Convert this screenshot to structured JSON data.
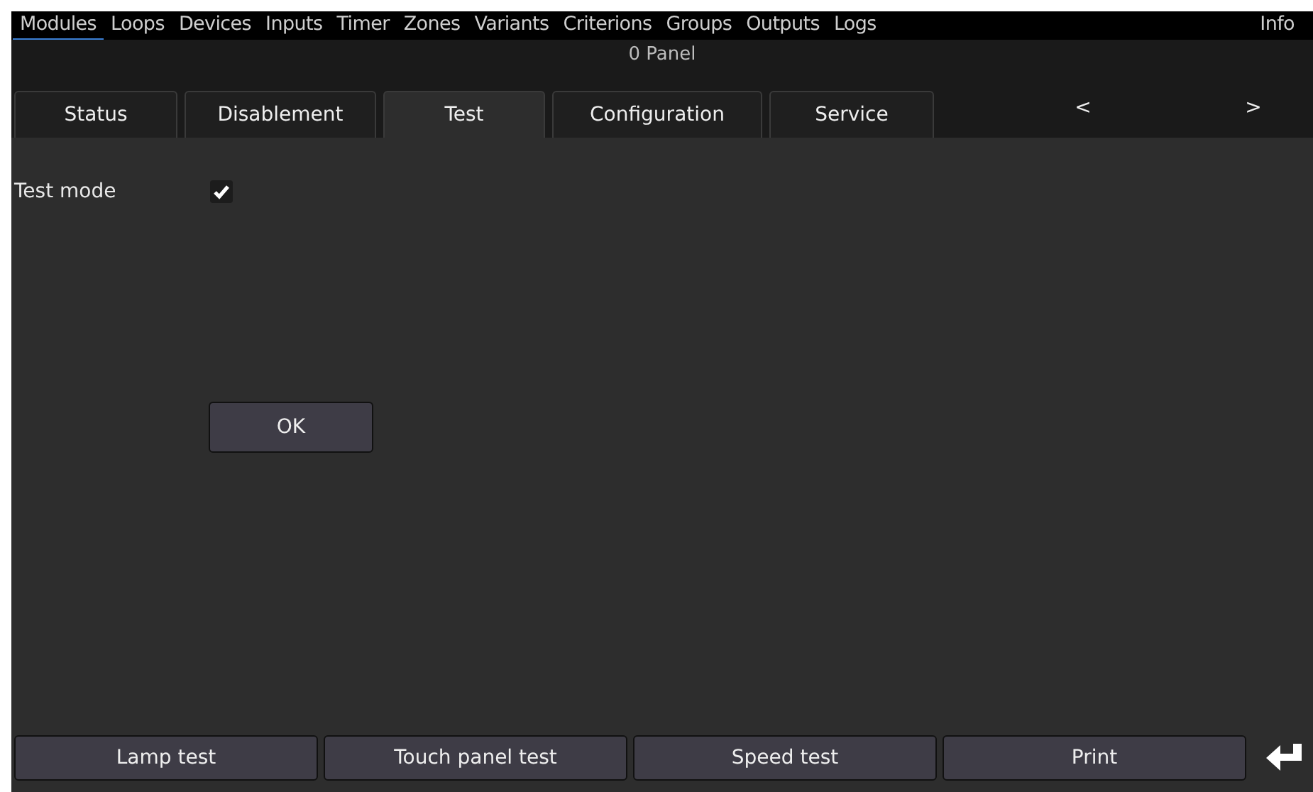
{
  "menu": [
    {
      "label": "Modules",
      "selected": true
    },
    {
      "label": "Loops",
      "selected": false
    },
    {
      "label": "Devices",
      "selected": false
    },
    {
      "label": "Inputs",
      "selected": false
    },
    {
      "label": "Timer",
      "selected": false
    },
    {
      "label": "Zones",
      "selected": false
    },
    {
      "label": "Variants",
      "selected": false
    },
    {
      "label": "Criterions",
      "selected": false
    },
    {
      "label": "Groups",
      "selected": false
    },
    {
      "label": "Outputs",
      "selected": false
    },
    {
      "label": "Logs",
      "selected": false
    },
    {
      "label": "Info",
      "selected": false
    }
  ],
  "subtitle": "0 Panel",
  "tabs": [
    {
      "label": "Status",
      "selected": false
    },
    {
      "label": "Disablement",
      "selected": false
    },
    {
      "label": "Test",
      "selected": true
    },
    {
      "label": "Configuration",
      "selected": false
    },
    {
      "label": "Service",
      "selected": false
    }
  ],
  "nav": [
    "<",
    ">"
  ],
  "test_mode": {
    "label": "Test mode",
    "checked": true
  },
  "ok_button": "OK",
  "bottom_buttons": [
    "Lamp test",
    "Touch panel test",
    "Speed test",
    "Print"
  ]
}
